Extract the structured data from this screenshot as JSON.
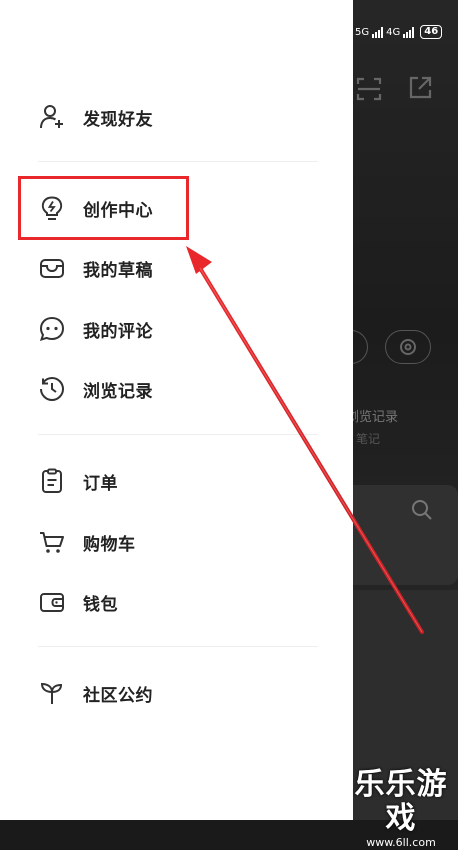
{
  "status_bar": {
    "signal_1": "5G",
    "signal_2": "4G",
    "battery": "46"
  },
  "background": {
    "history_label": "浏览记录",
    "notes_label": "笔记"
  },
  "drawer": {
    "menu": [
      {
        "label": "发现好友",
        "icon": "add-friend-icon"
      },
      {
        "label": "创作中心",
        "icon": "lightbulb-icon"
      },
      {
        "label": "我的草稿",
        "icon": "inbox-icon"
      },
      {
        "label": "我的评论",
        "icon": "comment-icon"
      },
      {
        "label": "浏览记录",
        "icon": "history-icon"
      },
      {
        "label": "订单",
        "icon": "clipboard-icon"
      },
      {
        "label": "购物车",
        "icon": "cart-icon"
      },
      {
        "label": "钱包",
        "icon": "wallet-icon"
      },
      {
        "label": "社区公约",
        "icon": "sprout-icon"
      }
    ]
  },
  "annotation": {
    "highlight_color": "#e8282b"
  },
  "watermark": {
    "title": "乐乐游戏",
    "url": "www.6ll.com"
  }
}
